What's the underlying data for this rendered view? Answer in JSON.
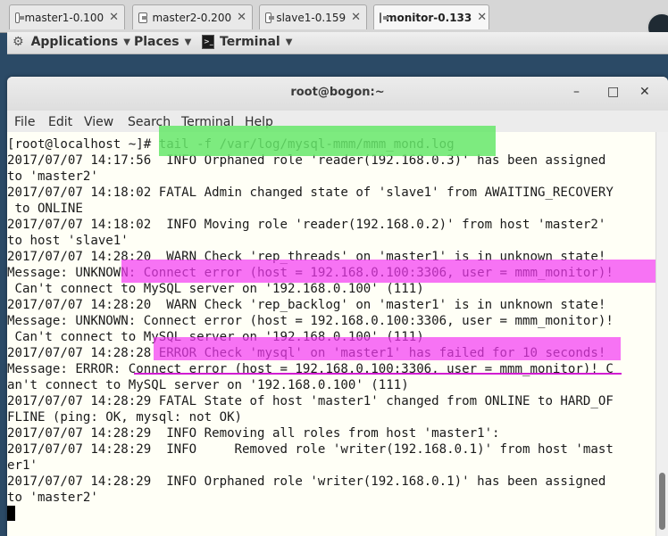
{
  "vm_tabs": [
    {
      "label": "master1-0.100",
      "close": "✕"
    },
    {
      "label": "master2-0.200",
      "close": "✕"
    },
    {
      "label": "slave1-0.159",
      "close": "✕"
    },
    {
      "label": "monitor-0.133",
      "close": "✕"
    }
  ],
  "panel": {
    "applications": "Applications",
    "places": "Places",
    "terminal": "Terminal"
  },
  "window": {
    "title": "root@bogon:~",
    "minimize": "–",
    "maximize": "□",
    "close": "✕"
  },
  "menu": [
    "File",
    "Edit",
    "View",
    "Search",
    "Terminal",
    "Help"
  ],
  "terminal_lines": [
    "[root@localhost ~]# tail -f /var/log/mysql-mmm/mmm_mond.log",
    "2017/07/07 14:17:56  INFO Orphaned role 'reader(192.168.0.3)' has been assigned",
    "to 'master2'",
    "2017/07/07 14:18:02 FATAL Admin changed state of 'slave1' from AWAITING_RECOVERY",
    " to ONLINE",
    "2017/07/07 14:18:02  INFO Moving role 'reader(192.168.0.2)' from host 'master2'",
    "to host 'slave1'",
    "2017/07/07 14:28:20  WARN Check 'rep_threads' on 'master1' is in unknown state!",
    "Message: UNKNOWN: Connect error (host = 192.168.0.100:3306, user = mmm_monitor)!",
    " Can't connect to MySQL server on '192.168.0.100' (111)",
    "2017/07/07 14:28:20  WARN Check 'rep_backlog' on 'master1' is in unknown state!",
    "Message: UNKNOWN: Connect error (host = 192.168.0.100:3306, user = mmm_monitor)!",
    " Can't connect to MySQL server on '192.168.0.100' (111)",
    "2017/07/07 14:28:28 ERROR Check 'mysql' on 'master1' has failed for 10 seconds!",
    "Message: ERROR: Connect error (host = 192.168.0.100:3306, user = mmm_monitor)! C",
    "an't connect to MySQL server on '192.168.0.100' (111)",
    "2017/07/07 14:28:29 FATAL State of host 'master1' changed from ONLINE to HARD_OF",
    "FLINE (ping: OK, mysql: not OK)",
    "2017/07/07 14:28:29  INFO Removing all roles from host 'master1':",
    "2017/07/07 14:28:29  INFO     Removed role 'writer(192.168.0.1)' from host 'mast",
    "er1'",
    "2017/07/07 14:28:29  INFO Orphaned role 'writer(192.168.0.1)' has been assigned",
    "to 'master2'"
  ],
  "colors": {
    "highlight_green": "#66e86a",
    "highlight_pink": "#f437f4",
    "terminal_bg": "#fffff6"
  }
}
